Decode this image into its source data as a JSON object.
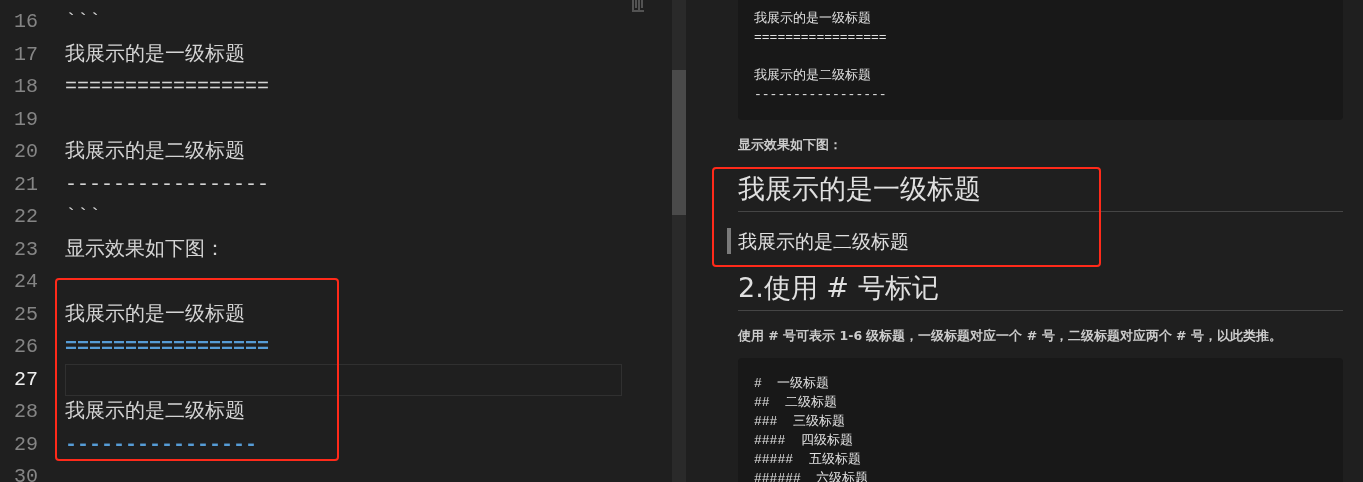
{
  "editor": {
    "lines": [
      {
        "number": "16",
        "text": "```",
        "kind": "plain",
        "current": false
      },
      {
        "number": "17",
        "text": "我展示的是一级标题",
        "kind": "plain",
        "current": false
      },
      {
        "number": "18",
        "text": "=================",
        "kind": "plain",
        "current": false
      },
      {
        "number": "19",
        "kind": "plain",
        "current": false
      },
      {
        "number": "20",
        "text": "我展示的是二级标题",
        "kind": "plain",
        "current": false
      },
      {
        "number": "21",
        "text": "-----------------",
        "kind": "plain",
        "current": false
      },
      {
        "number": "22",
        "text": "```",
        "kind": "plain",
        "current": false
      },
      {
        "number": "23",
        "text": "显示效果如下图：",
        "kind": "plain",
        "current": false
      },
      {
        "number": "24",
        "kind": "plain",
        "current": false
      },
      {
        "number": "25",
        "text": "我展示的是一级标题",
        "kind": "plain",
        "current": false
      },
      {
        "number": "26",
        "text": "=================",
        "kind": "marker",
        "current": false
      },
      {
        "number": "27",
        "kind": "plain",
        "current": true
      },
      {
        "number": "28",
        "text": "我展示的是二级标题",
        "kind": "plain",
        "current": false
      },
      {
        "number": "29",
        "text": "----------------",
        "kind": "marker",
        "current": false
      },
      {
        "number": "30",
        "kind": "plain",
        "current": false
      }
    ]
  },
  "preview": {
    "blocks": [
      {
        "kind": "code",
        "groups": [
          [
            "我展示的是一级标题",
            "================="
          ],
          [
            "我展示的是二级标题",
            "-----------------"
          ]
        ]
      },
      {
        "kind": "paragraph",
        "text": "显示效果如下图："
      },
      {
        "kind": "h1",
        "text": "我展示的是一级标题",
        "synced": false
      },
      {
        "kind": "h2",
        "text": "我展示的是二级标题",
        "synced": true
      },
      {
        "kind": "h1",
        "text": "2.使用 # 号标记",
        "synced": false
      },
      {
        "kind": "paragraph",
        "text": "使用 # 号可表示 1-6 级标题，一级标题对应一个 # 号，二级标题对应两个 # 号，以此类推。"
      },
      {
        "kind": "code",
        "groups": [
          [
            "#  一级标题",
            "##  二级标题",
            "###  三级标题",
            "####  四级标题",
            "#####  五级标题",
            "######  六级标题"
          ]
        ]
      }
    ]
  }
}
